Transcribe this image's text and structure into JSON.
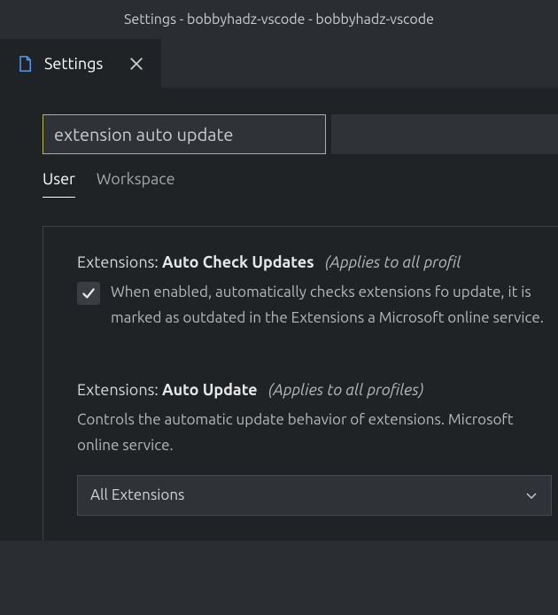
{
  "titleBar": "Settings - bobbyhadz-vscode - bobbyhadz-vscode",
  "tab": {
    "label": "Settings"
  },
  "search": {
    "value": "extension auto update"
  },
  "scopeTabs": {
    "user": "User",
    "workspace": "Workspace"
  },
  "settings": [
    {
      "category": "Extensions: ",
      "name": "Auto Check Updates",
      "scope": "(Applies to all profil",
      "description": "When enabled, automatically checks extensions fo update, it is marked as outdated in the Extensions a Microsoft online service.",
      "checked": true
    },
    {
      "category": "Extensions: ",
      "name": "Auto Update",
      "scope": "(Applies to all profiles)",
      "description": "Controls the automatic update behavior of extensions. Microsoft online service.",
      "dropdownValue": "All Extensions"
    }
  ]
}
